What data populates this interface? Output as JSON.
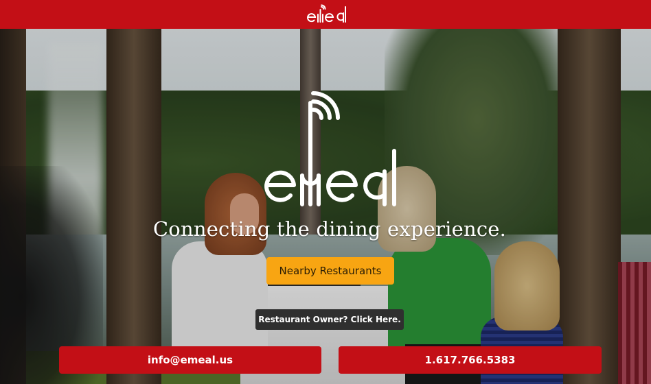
{
  "header": {
    "logo_text": "emeal"
  },
  "hero": {
    "logo_text": "emeal",
    "tagline": "Connecting the dining experience.",
    "nearby_button": "Nearby Restaurants",
    "owner_button": "Restaurant Owner? Click Here."
  },
  "contact": {
    "email": "info@emeal.us",
    "phone": "1.617.766.5383"
  },
  "colors": {
    "brand_red": "#c30f16",
    "accent_orange": "#f8a512",
    "dark_button": "#2f2f2f"
  },
  "icons": {
    "logo_mark": "fork-wifi-icon"
  }
}
